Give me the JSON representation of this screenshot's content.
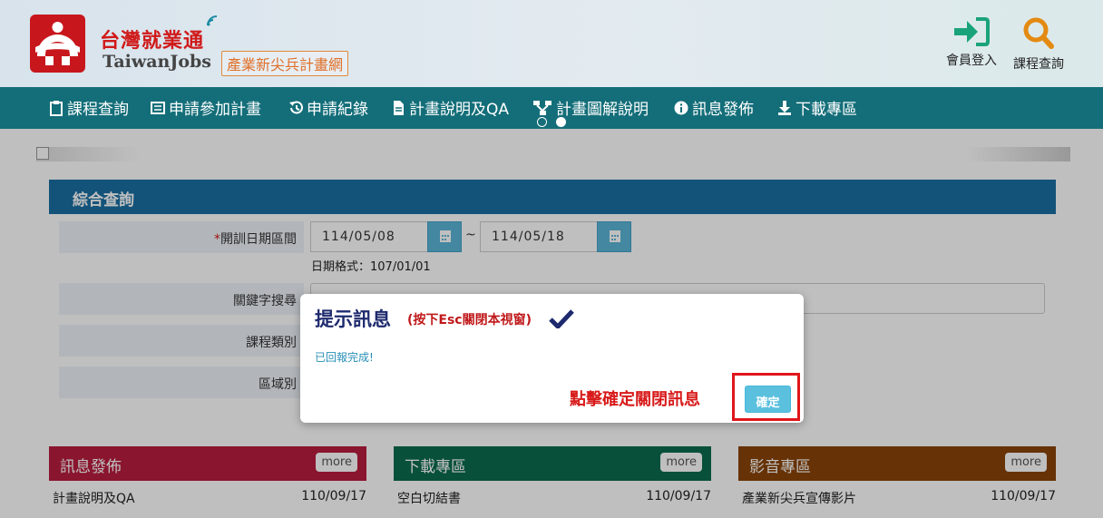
{
  "header": {
    "logo_cn": "台灣就業通",
    "logo_en": "TaiwanJobs",
    "logo_sub": "產業新尖兵計畫網",
    "login_label": "會員登入",
    "search_label": "課程查詢",
    "login_icon": "sign-in-icon",
    "search_icon": "magnifier-icon",
    "login_color": "#1aa37a",
    "search_color": "#e38a12"
  },
  "nav": {
    "items": [
      {
        "label": "課程查詢",
        "icon": "clipboard-icon"
      },
      {
        "label": "申請參加計畫",
        "icon": "list-icon"
      },
      {
        "label": "申請紀錄",
        "icon": "history-icon"
      },
      {
        "label": "計畫說明及QA",
        "icon": "document-icon"
      },
      {
        "label": "計畫圖解說明",
        "icon": "sitemap-icon"
      },
      {
        "label": "訊息發佈",
        "icon": "info-icon"
      },
      {
        "label": "下載專區",
        "icon": "download-icon"
      }
    ]
  },
  "search_panel": {
    "title": "綜合查詢",
    "date_label": "開訓日期區間",
    "required_mark": "*",
    "date_from": "114/05/08",
    "date_sep": "~",
    "date_to": "114/05/18",
    "date_format": "日期格式：107/01/01",
    "keyword_label": "關鍵字搜尋",
    "category_label": "課程類別",
    "region_label": "區域別"
  },
  "sections": [
    {
      "title": "訊息發佈",
      "more": "more",
      "color": "#b81d3e",
      "item": "計畫說明及QA",
      "date": "110/09/17"
    },
    {
      "title": "下載專區",
      "more": "more",
      "color": "#0b6b4e",
      "item": "空白切結書",
      "date": "110/09/17"
    },
    {
      "title": "影音專區",
      "more": "more",
      "color": "#8a4308",
      "item": "產業新尖兵宣傳影片",
      "date": "110/09/17"
    }
  ],
  "dialog": {
    "title": "提示訊息",
    "hint": "(按下Esc關閉本視窗)",
    "message": "已回報完成!",
    "note": "點擊確定關閉訊息",
    "ok_label": "確定"
  }
}
